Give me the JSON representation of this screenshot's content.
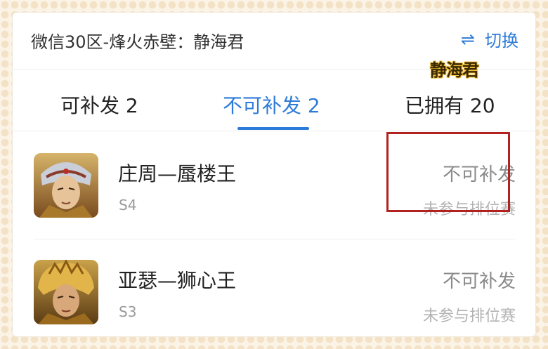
{
  "header": {
    "server_title": "微信30区-烽火赤壁：静海君",
    "switch_icon": "⇌",
    "switch_label": "切换"
  },
  "watermark": "静海君",
  "tabs": [
    {
      "label": "可补发 2",
      "active": false
    },
    {
      "label": "不可补发 2",
      "active": true
    },
    {
      "label": "已拥有 20",
      "active": false
    }
  ],
  "items": [
    {
      "name": "庄周—蜃楼王",
      "season": "S4",
      "status": "不可补发",
      "reason": "未参与排位赛",
      "avatar_icon": "zhuangzhou-skin-avatar"
    },
    {
      "name": "亚瑟—狮心王",
      "season": "S3",
      "status": "不可补发",
      "reason": "未参与排位赛",
      "avatar_icon": "arthur-skin-avatar"
    }
  ],
  "colors": {
    "accent": "#2d7bd8",
    "highlight": "#b2231f",
    "background": "#fbf3e6"
  }
}
